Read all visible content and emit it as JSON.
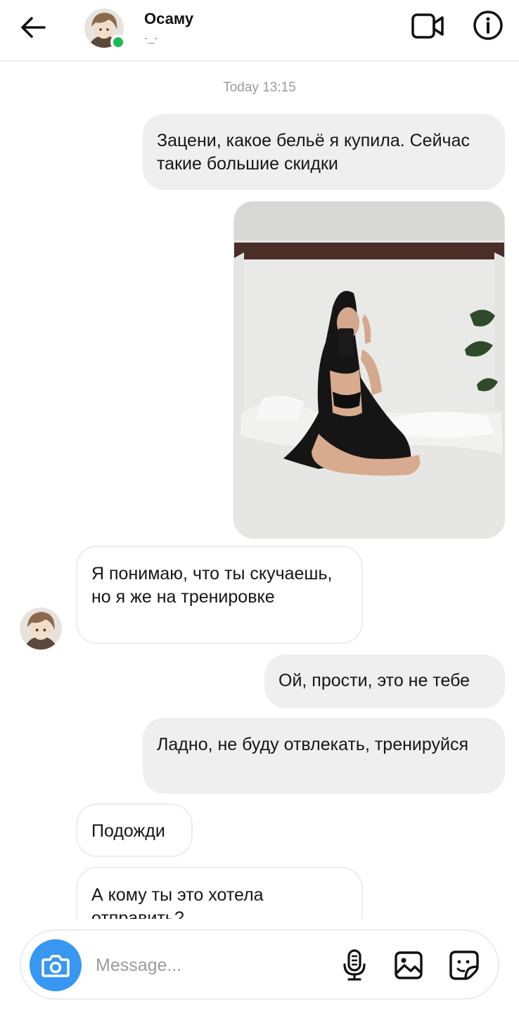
{
  "header": {
    "name": "Осаму",
    "status": "-_-",
    "back_icon": "arrow-left-icon",
    "video_icon": "video-camera-icon",
    "info_icon": "info-icon",
    "online_color": "#1db954"
  },
  "thread": {
    "timestamp": "Today 13:15",
    "messages": [
      {
        "sender": "me",
        "type": "text",
        "text": "Зацени, какое бельё я купила. Сейчас  такие большие скидки"
      },
      {
        "sender": "me",
        "type": "photo",
        "description": "photo"
      },
      {
        "sender": "them",
        "type": "text",
        "text": "Я понимаю, что ты скучаешь, но я же на тренировке"
      },
      {
        "sender": "me",
        "type": "text",
        "text": "Ой, прости, это не тебе"
      },
      {
        "sender": "me",
        "type": "text",
        "text": "Ладно, не буду отвлекать, тренируйся"
      },
      {
        "sender": "them",
        "type": "text",
        "text": "Подожди"
      },
      {
        "sender": "them",
        "type": "text",
        "text": "А кому ты это хотела отправить?"
      }
    ]
  },
  "composer": {
    "placeholder": "Message...",
    "camera_icon": "camera-icon",
    "mic_icon": "microphone-icon",
    "gallery_icon": "gallery-icon",
    "sticker_icon": "sticker-icon",
    "accent_color": "#3897f0"
  }
}
